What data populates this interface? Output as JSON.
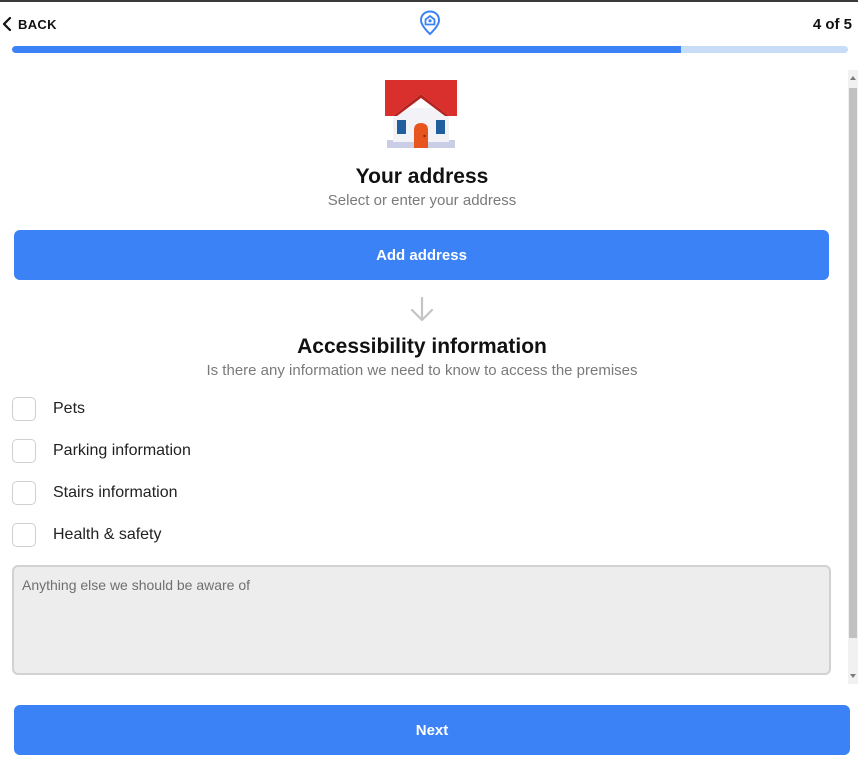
{
  "header": {
    "back_label": "BACK",
    "step_indicator": "4 of 5",
    "progress_fraction": 0.8,
    "logo_icon": "location-pin-icon"
  },
  "address": {
    "icon": "house-icon",
    "title": "Your address",
    "subtitle": "Select or enter your address",
    "add_button_label": "Add address"
  },
  "accessibility": {
    "divider_icon": "arrow-down-icon",
    "title": "Accessibility information",
    "subtitle": "Is there any information we need to know to access the premises",
    "options": [
      {
        "label": "Pets",
        "checked": false
      },
      {
        "label": "Parking information",
        "checked": false
      },
      {
        "label": "Stairs information",
        "checked": false
      },
      {
        "label": "Health & safety",
        "checked": false
      }
    ],
    "notes_placeholder": "Anything else we should be aware of",
    "notes_value": ""
  },
  "footer": {
    "next_label": "Next"
  },
  "colors": {
    "accent": "#3b82f6",
    "progress_track": "#c7dcf7",
    "muted_text": "#7a7a7a",
    "field_bg": "#ededed"
  }
}
